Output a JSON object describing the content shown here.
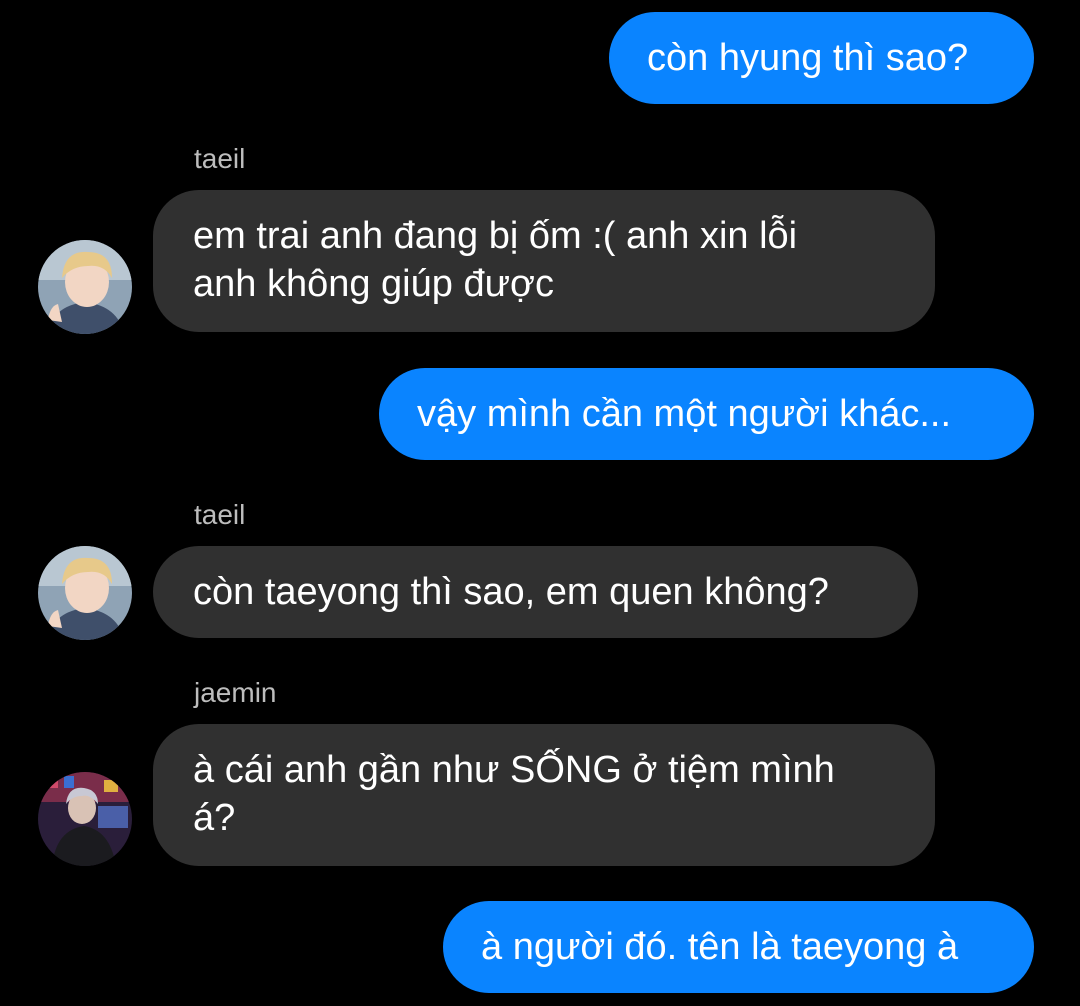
{
  "messages": [
    {
      "direction": "outgoing",
      "text": "còn hyung thì sao?"
    },
    {
      "direction": "incoming",
      "sender": "taeil",
      "lines": [
        "em trai anh đang bị ốm :( anh xin lỗi",
        "anh không giúp được"
      ]
    },
    {
      "direction": "outgoing",
      "text": "vậy mình cần một người khác..."
    },
    {
      "direction": "incoming",
      "sender": "taeil",
      "lines": [
        "còn taeyong thì sao, em quen không?"
      ]
    },
    {
      "direction": "incoming",
      "sender": "jaemin",
      "lines": [
        "à cái anh gần như SỐNG ở tiệm mình",
        "á?"
      ]
    },
    {
      "direction": "outgoing",
      "text": "à người đó. tên là taeyong à"
    }
  ],
  "colors": {
    "background": "#000000",
    "outgoing_bubble": "#0a84ff",
    "incoming_bubble": "#303030",
    "sender_name": "#bdbdbd"
  }
}
